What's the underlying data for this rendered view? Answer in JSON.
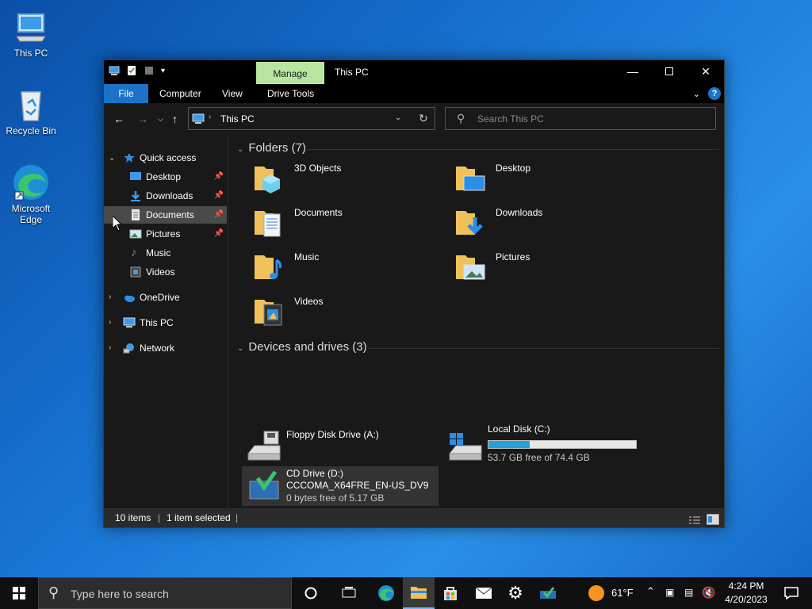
{
  "desktop": {
    "icons": [
      {
        "label": "This PC"
      },
      {
        "label": "Recycle Bin"
      },
      {
        "label": "Microsoft Edge"
      }
    ]
  },
  "window": {
    "title": "This PC",
    "manage_tab": "Manage",
    "ribbon_tabs": [
      "File",
      "Computer",
      "View",
      "Drive Tools"
    ],
    "help_label": "?",
    "address": "This PC",
    "search_placeholder": "Search This PC"
  },
  "nav_pane": {
    "items": [
      {
        "label": "Quick access"
      },
      {
        "label": "Desktop"
      },
      {
        "label": "Downloads"
      },
      {
        "label": "Documents"
      },
      {
        "label": "Pictures"
      },
      {
        "label": "Music"
      },
      {
        "label": "Videos"
      },
      {
        "label": "OneDrive"
      },
      {
        "label": "This PC"
      },
      {
        "label": "Network"
      }
    ]
  },
  "content": {
    "folders_header": "Folders (7)",
    "folders": [
      {
        "name": "3D Objects"
      },
      {
        "name": "Desktop"
      },
      {
        "name": "Documents"
      },
      {
        "name": "Downloads"
      },
      {
        "name": "Music"
      },
      {
        "name": "Pictures"
      },
      {
        "name": "Videos"
      }
    ],
    "devices_header": "Devices and drives (3)",
    "drives": [
      {
        "name": "Floppy Disk Drive (A:)"
      },
      {
        "name": "Local Disk (C:)",
        "free": "53.7 GB free of 74.4 GB",
        "used_fraction": 0.28
      },
      {
        "name": "CD Drive (D:)",
        "label": "CCCOMA_X64FRE_EN-US_DV9",
        "free": "0 bytes free of 5.17 GB"
      }
    ]
  },
  "status": {
    "items": "10 items",
    "selected": "1 item selected"
  },
  "taskbar": {
    "search_placeholder": "Type here to search",
    "weather": "61°F",
    "time": "4:24 PM",
    "date": "4/20/2023"
  },
  "colors": {
    "accent": "#1a73c8",
    "manage_tab": "#b8e6a0",
    "drive_bar": "#26a0da"
  }
}
